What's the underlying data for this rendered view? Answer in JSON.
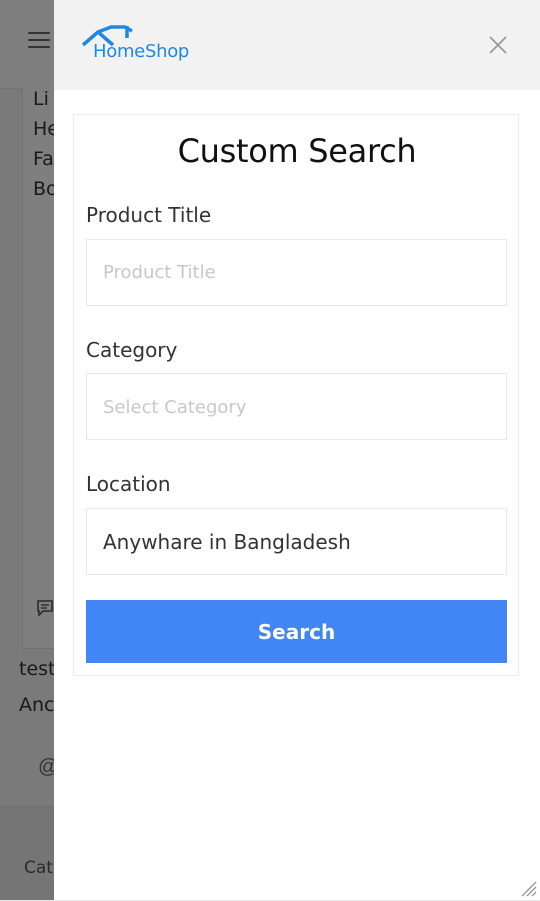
{
  "background": {
    "menu_items": [
      "Li",
      "He",
      "Fa",
      "Bo"
    ],
    "text_line1": "test",
    "text_line2": "Anc",
    "at_symbol": "@",
    "footer_text": "Cat"
  },
  "drawer": {
    "logo_text": "HomeShop",
    "brand_color": "#1e88e5",
    "close_icon": "close-icon"
  },
  "search_panel": {
    "title": "Custom Search",
    "product_title": {
      "label": "Product Title",
      "placeholder": "Product Title",
      "value": ""
    },
    "category": {
      "label": "Category",
      "selected": "Select Category"
    },
    "location": {
      "label": "Location",
      "selected": "Anywhare in Bangladesh"
    },
    "search_button": {
      "label": "Search",
      "color": "#4285f4"
    }
  }
}
